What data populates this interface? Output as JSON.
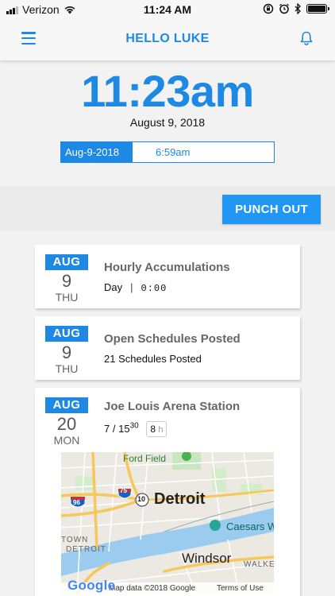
{
  "status_bar": {
    "carrier": "Verizon",
    "time": "11:24 AM"
  },
  "header": {
    "title": "HELLO LUKE",
    "menu_icon": "hamburger-menu-icon",
    "notification_icon": "bell-icon"
  },
  "clock": {
    "time": "11:23am",
    "date": "August 9, 2018"
  },
  "punch_record": {
    "date": "Aug-9-2018",
    "time": "6:59am"
  },
  "actions": {
    "punch_out_label": "PUNCH OUT"
  },
  "cards": [
    {
      "month": "AUG",
      "day": "9",
      "weekday": "THU",
      "title": "Hourly Accumulations",
      "period_label": "Day",
      "separator": "|",
      "value": "0:00"
    },
    {
      "month": "AUG",
      "day": "9",
      "weekday": "THU",
      "title": "Open Schedules Posted",
      "subtitle": "21 Schedules Posted"
    },
    {
      "month": "AUG",
      "day": "20",
      "weekday": "MON",
      "title": "Joe Louis Arena Station",
      "shift_start": "7",
      "shift_sep": "/",
      "shift_end": "15",
      "shift_end_minutes": "30",
      "hours_value": "8",
      "hours_unit": "h",
      "map": {
        "labels": {
          "ford_field": "Ford Field",
          "detroit": "Detroit",
          "caesars": "Caesars W",
          "town": "TOWN",
          "town_detroit": "DETROIT",
          "windsor": "Windsor",
          "walker": "WALKE",
          "route_75": "75",
          "route_96": "96",
          "route_10": "10"
        },
        "attribution": "Map data ©2018 Google",
        "terms": "Terms of Use",
        "logo": "Google"
      }
    }
  ],
  "colors": {
    "accent": "#1e88e5",
    "button": "#2196f3"
  }
}
